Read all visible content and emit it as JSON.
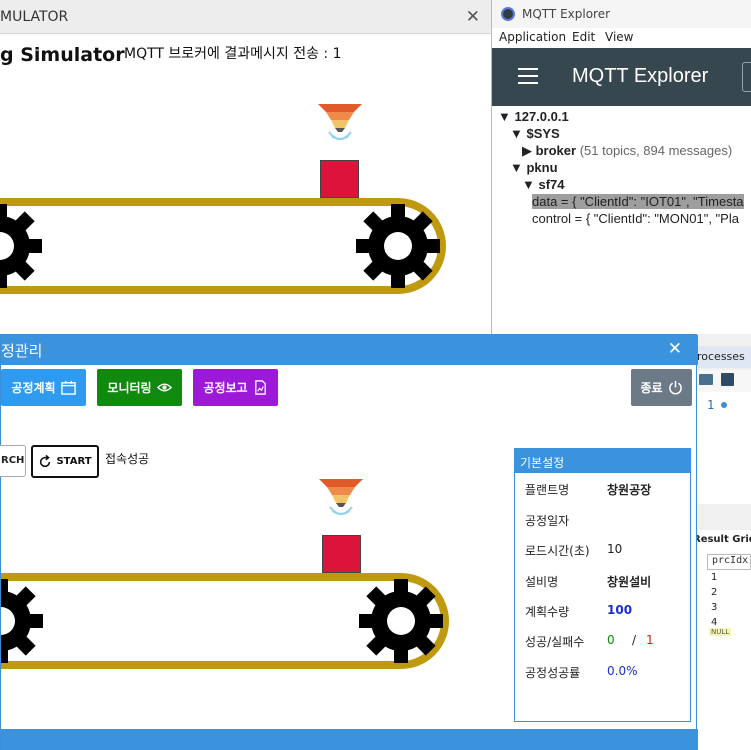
{
  "simulator": {
    "window_title": "MULATOR",
    "heading": "g Simulator",
    "status_text": "MQTT 브로커에 결과메시지 전송 : 1"
  },
  "mqtt": {
    "window_title": "MQTT Explorer",
    "menu": [
      "Application",
      "Edit",
      "View"
    ],
    "header_title": "MQTT Explorer",
    "tree": {
      "root": "127.0.0.1",
      "sys": "$SYS",
      "broker": "broker",
      "broker_meta": "(51 topics, 894 messages)",
      "pknu": "pknu",
      "sf74": "sf74",
      "data_row": "data = { \"ClientId\": \"IOT01\", \"Timesta",
      "control_row": "control = { \"ClientId\": \"MON01\", \"Pla"
    }
  },
  "ssms": {
    "tab_label": "rocesses",
    "line_number": "1",
    "grid_label": "Result Grid",
    "grid_header": "prcIdx",
    "grid_rows": [
      "1",
      "2",
      "3",
      "4"
    ],
    "null_badge": "NULL"
  },
  "process": {
    "window_title": "정관리",
    "buttons": {
      "plan": "공정계획",
      "monitor": "모니터링",
      "report": "공정보고",
      "exit": "종료",
      "search": "RCH",
      "start": "START"
    },
    "connection_status": "접속성공",
    "settings": {
      "header": "기본설정",
      "rows": [
        {
          "key": "플랜트명",
          "value": "창원공장"
        },
        {
          "key": "공정일자",
          "value": ""
        },
        {
          "key": "로드시간(초)",
          "value": "10"
        },
        {
          "key": "설비명",
          "value": "창원설비"
        },
        {
          "key": "계획수량",
          "value": "100"
        },
        {
          "key": "성공/실패수",
          "success": "0",
          "sep": "/",
          "fail": "1"
        },
        {
          "key": "공정성공률",
          "value": "0.0%"
        }
      ]
    }
  },
  "colors": {
    "belt": "#c09a0e",
    "box": "#dc143c",
    "btn_plan": "#2f9bf0",
    "btn_monitor": "#0f8a0f",
    "btn_report": "#9c19d8",
    "btn_exit": "#6c7a88",
    "titlebar_blue": "#3b93dd",
    "mqtt_header": "#37474f"
  }
}
